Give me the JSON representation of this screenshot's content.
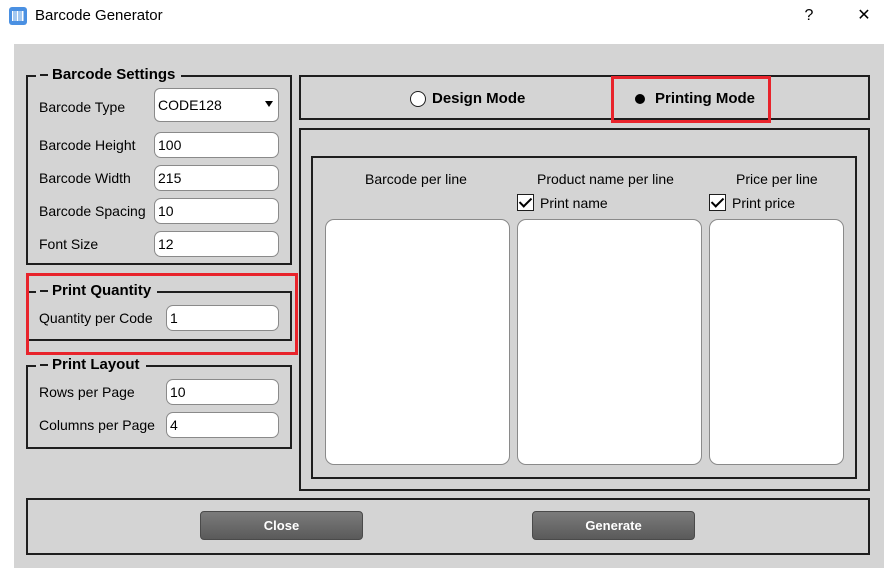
{
  "window": {
    "title": "Barcode Generator",
    "help_glyph": "?",
    "close_glyph": "✕"
  },
  "barcode_settings": {
    "legend": "Barcode Settings",
    "type_label": "Barcode Type",
    "type_value": "CODE128",
    "height_label": "Barcode Height",
    "height_value": "100",
    "width_label": "Barcode Width",
    "width_value": "215",
    "spacing_label": "Barcode Spacing",
    "spacing_value": "10",
    "font_size_label": "Font Size",
    "font_size_value": "12"
  },
  "print_quantity": {
    "legend": "Print Quantity",
    "qty_label": "Quantity per Code",
    "qty_value": "1"
  },
  "print_layout": {
    "legend": "Print Layout",
    "rows_label": "Rows per Page",
    "rows_value": "10",
    "cols_label": "Columns per Page",
    "cols_value": "4"
  },
  "mode": {
    "design_label": "Design Mode",
    "printing_label": "Printing Mode",
    "selected": "Printing Mode"
  },
  "printing": {
    "barcode_header": "Barcode per line",
    "product_header": "Product name per line",
    "price_header": "Price per line",
    "print_name_label": "Print name",
    "print_price_label": "Print price"
  },
  "actions": {
    "close_label": "Close",
    "generate_label": "Generate"
  },
  "colors": {
    "panel_bg": "#d4d4d4",
    "highlight_red": "#e8232b",
    "button_gray": "#6a6a6a"
  }
}
